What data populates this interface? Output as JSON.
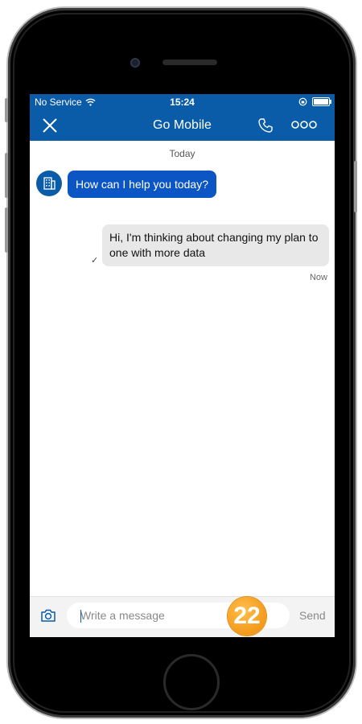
{
  "status_bar": {
    "carrier": "No Service",
    "time": "15:24"
  },
  "header": {
    "title": "Go Mobile"
  },
  "chat": {
    "date_separator": "Today",
    "messages": [
      {
        "direction": "incoming",
        "text": "How can I help you today?"
      },
      {
        "direction": "outgoing",
        "text": "Hi, I'm thinking about changing my plan to one with more data",
        "timestamp": "Now",
        "status_mark": "✓"
      }
    ]
  },
  "composer": {
    "placeholder": "Write a message",
    "send_label": "Send"
  },
  "annotation_badge": "22",
  "colors": {
    "brand_blue": "#0a5ca8",
    "incoming_bubble": "#0b56c4",
    "outgoing_bubble": "#e8e8e8",
    "badge_orange": "#f39a1a"
  },
  "icons": {
    "close": "close-icon",
    "call": "phone-icon",
    "more": "more-options-icon",
    "camera": "camera-icon",
    "avatar": "building-icon",
    "wifi": "wifi-icon",
    "battery": "battery-icon"
  }
}
